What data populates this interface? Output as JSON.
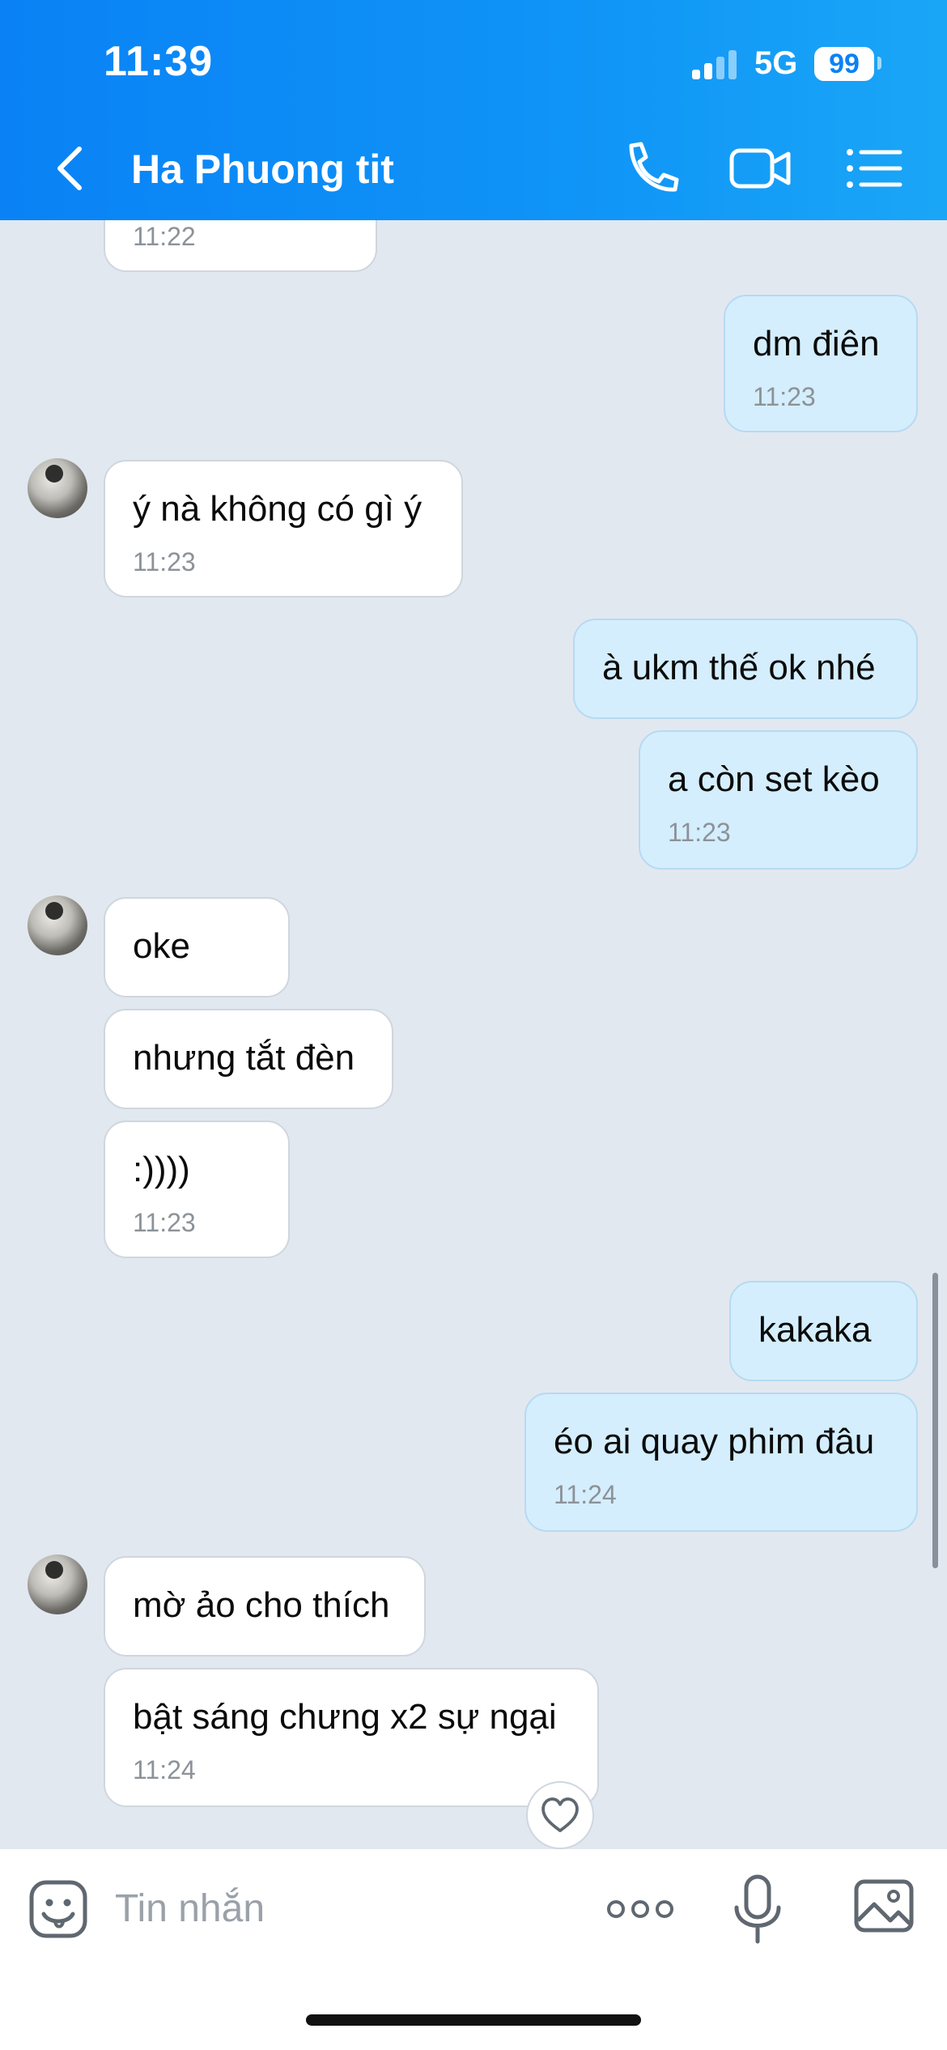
{
  "status": {
    "time": "11:39",
    "network": "5G",
    "battery": "99"
  },
  "header": {
    "title": "Ha Phuong tit"
  },
  "icons": {
    "back": "chevron-left-icon",
    "call": "phone-icon",
    "video": "video-camera-icon",
    "menu": "list-icon",
    "emoji": "sticker-icon",
    "more": "more-dots-icon",
    "mic": "microphone-icon",
    "image": "image-icon",
    "reaction": "heart-icon"
  },
  "colors": {
    "header": "#0a82f5",
    "incoming_bubble": "#ffffff",
    "outgoing_bubble": "#d4eefd",
    "background": "#e2e8f0"
  },
  "messages": [
    {
      "dir": "in",
      "text": "",
      "time": "11:22"
    },
    {
      "dir": "out",
      "text": "dm điên",
      "time": "11:23"
    },
    {
      "dir": "in",
      "text": "ý nà không có gì ý",
      "time": "11:23"
    },
    {
      "dir": "out",
      "text": "à ukm thế ok nhé",
      "time": ""
    },
    {
      "dir": "out",
      "text": "a còn set kèo",
      "time": "11:23"
    },
    {
      "dir": "in",
      "text": "oke",
      "time": ""
    },
    {
      "dir": "in",
      "text": "nhưng tắt đèn",
      "time": ""
    },
    {
      "dir": "in",
      "text": ":))))",
      "time": "11:23"
    },
    {
      "dir": "out",
      "text": "kakaka",
      "time": ""
    },
    {
      "dir": "out",
      "text": "éo ai quay phim đâu",
      "time": "11:24"
    },
    {
      "dir": "in",
      "text": "mờ ảo cho thích",
      "time": ""
    },
    {
      "dir": "in",
      "text": "bật sáng chưng x2 sự ngại",
      "time": "11:24"
    }
  ],
  "composer": {
    "placeholder": "Tin nhắn"
  }
}
